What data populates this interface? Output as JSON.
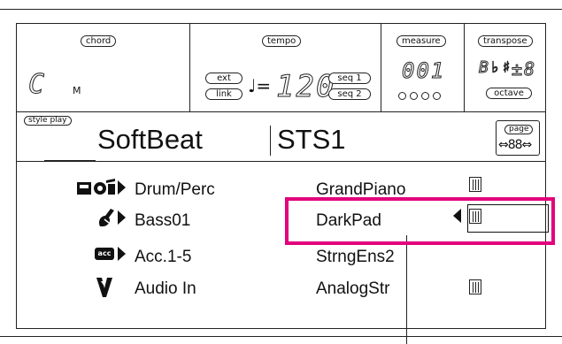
{
  "header": {
    "chord_label": "chord",
    "chord_value": "C",
    "chord_type": "M",
    "tempo_label": "tempo",
    "ext_label": "ext",
    "link_label": "link",
    "tempo_symbol": "♩=",
    "tempo_value": "120",
    "seq1_label": "seq 1",
    "seq2_label": "seq 2",
    "measure_label": "measure",
    "measure_value": "001",
    "transpose_label": "transpose",
    "transpose_accidentals": "B♭♯",
    "transpose_value": "±8",
    "octave_label": "octave"
  },
  "style_bar": {
    "mode_label": "style play",
    "style_name": "SoftBeat",
    "sts_name": "STS1",
    "page_label": "page",
    "page_value": "⇔88⇔"
  },
  "tracks": [
    {
      "label": "Drum/Perc",
      "icon": "drum-icon"
    },
    {
      "label": "Bass01",
      "icon": "bass-icon"
    },
    {
      "label": "Acc.1-5",
      "icon": "acc-icon",
      "icon_text": "acc"
    },
    {
      "label": "Audio In",
      "icon": "audio-in-icon"
    }
  ],
  "keyboard_sounds": [
    "GrandPiano",
    "DarkPad",
    "StrngEns2",
    "AnalogStr"
  ],
  "colors": {
    "highlight": "#e3007d",
    "ink": "#111111"
  }
}
